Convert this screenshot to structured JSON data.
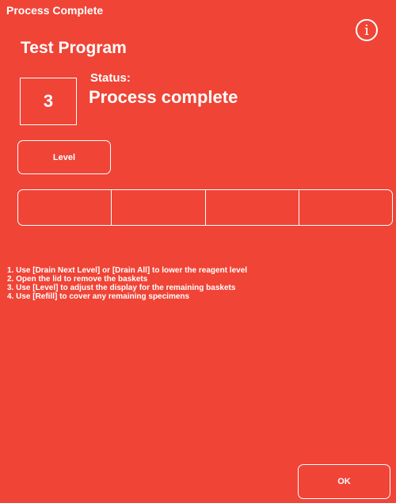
{
  "header": {
    "title": "Process Complete",
    "info_glyph": "i",
    "info_icon": "info-icon"
  },
  "program": {
    "name": "Test Program"
  },
  "step": {
    "number": "3"
  },
  "status": {
    "label": "Status:",
    "value": "Process complete"
  },
  "buttons": {
    "level": "Level",
    "ok": "OK"
  },
  "baskets": {
    "count": 4
  },
  "instructions": [
    "1. Use [Drain Next Level] or [Drain All] to lower the reagent level",
    "2. Open the lid to remove the baskets",
    "3. Use [Level] to adjust the display for the remaining baskets",
    "4. Use [Refill] to cover any remaining specimens"
  ],
  "colors": {
    "background": "#f04436",
    "foreground": "#ffffff"
  }
}
